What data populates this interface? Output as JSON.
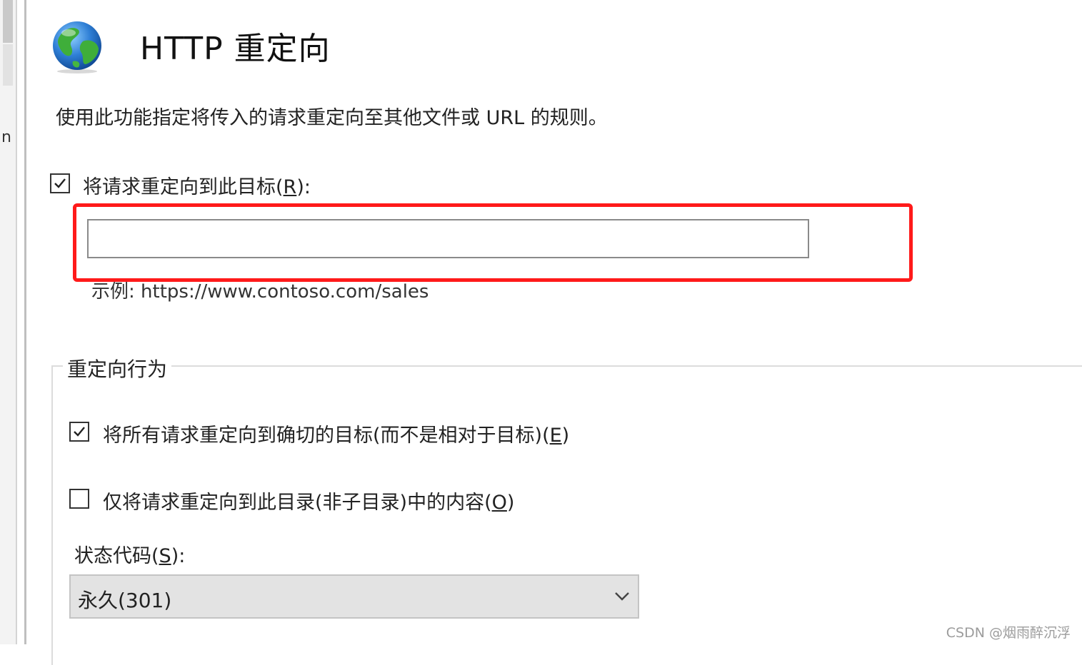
{
  "header": {
    "title": "HTTP 重定向",
    "icon": "globe-icon"
  },
  "description": "使用此功能指定将传入的请求重定向至其他文件或 URL 的规则。",
  "redirect_target": {
    "checkbox_checked": true,
    "label_prefix": "将请求重定向到此目标(",
    "label_accel": "R",
    "label_suffix": "):",
    "input_value": "",
    "example": "示例: https://www.contoso.com/sales"
  },
  "redirect_behavior": {
    "legend": "重定向行为",
    "exact_destination": {
      "checked": true,
      "label_prefix": "将所有请求重定向到确切的目标(而不是相对于目标)(",
      "label_accel": "E",
      "label_suffix": ")"
    },
    "only_this_directory": {
      "checked": false,
      "label_prefix": "仅将请求重定向到此目录(非子目录)中的内容(",
      "label_accel": "O",
      "label_suffix": ")"
    },
    "status_code": {
      "label_prefix": "状态代码(",
      "label_accel": "S",
      "label_suffix": "):",
      "selected": "永久(301)"
    }
  },
  "left_pane": {
    "fragment": "n"
  },
  "watermark": "CSDN @烟雨醉沉浮",
  "colors": {
    "highlight_border": "#ff1a1a",
    "select_background": "#e3e3e3"
  }
}
